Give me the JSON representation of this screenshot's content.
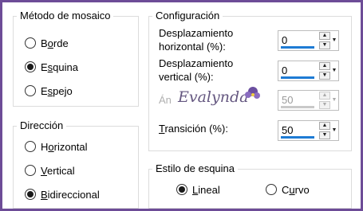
{
  "metodo_mosaico": {
    "title": "Método de mosaico",
    "options": [
      {
        "label": "Borde",
        "mnemonic_index": 1,
        "checked": false
      },
      {
        "label": "Esquina",
        "mnemonic_index": 1,
        "checked": true
      },
      {
        "label": "Espejo",
        "mnemonic_index": 1,
        "checked": false
      }
    ]
  },
  "direccion": {
    "title": "Dirección",
    "options": [
      {
        "label": "Horizontal",
        "mnemonic_index": 1,
        "checked": false
      },
      {
        "label": "Vertical",
        "mnemonic_index": 0,
        "checked": false
      },
      {
        "label": "Bidireccional",
        "mnemonic_index": 0,
        "checked": true
      }
    ]
  },
  "configuracion": {
    "title": "Configuración",
    "desplazamiento_horizontal": {
      "label_line1": "Desplazamiento",
      "label_line2": "horizontal (%):",
      "value": "0"
    },
    "desplazamiento_vertical": {
      "label_line1": "Desplazamiento",
      "label_line2": "vertical (%):",
      "value": "0"
    },
    "angulo": {
      "label": "Án",
      "value": "50"
    },
    "transicion": {
      "label": "Transición (%):",
      "value": "50"
    }
  },
  "estilo_esquina": {
    "title": "Estilo de esquina",
    "options": [
      {
        "label": "Lineal",
        "mnemonic_index": 0,
        "checked": true
      },
      {
        "label": "Curvo",
        "mnemonic_index": 1,
        "checked": false
      }
    ]
  },
  "watermark": {
    "text": "Evalynda"
  },
  "colors": {
    "accent": "#1e7bd4",
    "border": "#6d4c97"
  }
}
